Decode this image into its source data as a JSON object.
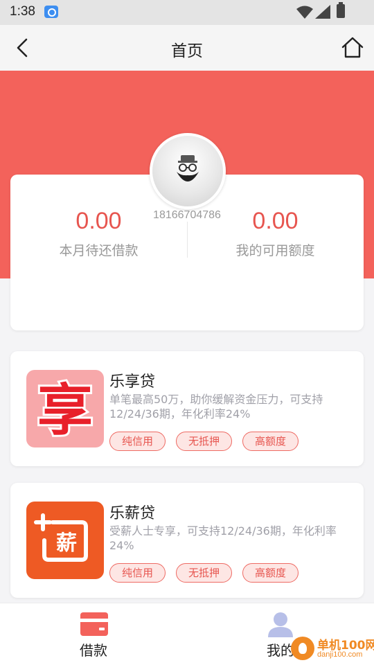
{
  "status_bar": {
    "time": "1:38"
  },
  "nav": {
    "title": "首页"
  },
  "profile": {
    "phone": "18166704786"
  },
  "summary": {
    "due_this_month": {
      "value": "0.00",
      "label": "本月待还借款"
    },
    "available_credit": {
      "value": "0.00",
      "label": "我的可用额度"
    }
  },
  "products": [
    {
      "name": "乐享贷",
      "desc": "单笔最高50万，助你缓解资金压力，可支持12/24/36期，年化利率24%",
      "icon_glyph": "享",
      "tags": [
        "纯信用",
        "无抵押",
        "高额度"
      ]
    },
    {
      "name": "乐薪贷",
      "desc": "受薪人士专享，可支持12/24/36期，年化利率24%",
      "icon_glyph": "薪",
      "tags": [
        "纯信用",
        "无抵押",
        "高额度"
      ]
    }
  ],
  "tabbar": {
    "loan_label": "借款",
    "mine_label": "我的"
  },
  "watermark": {
    "name": "单机100网",
    "url": "danji100.com"
  },
  "colors": {
    "accent": "#f3625b",
    "value_red": "#e7554f",
    "tag_bg": "#fde6e4",
    "icon_orange": "#ee5a24"
  },
  "icons": {
    "back": "chevron-left-icon",
    "home": "home-icon",
    "avatar": "bearded-man-icon",
    "loan_tab": "card-icon",
    "mine_tab": "user-icon"
  }
}
